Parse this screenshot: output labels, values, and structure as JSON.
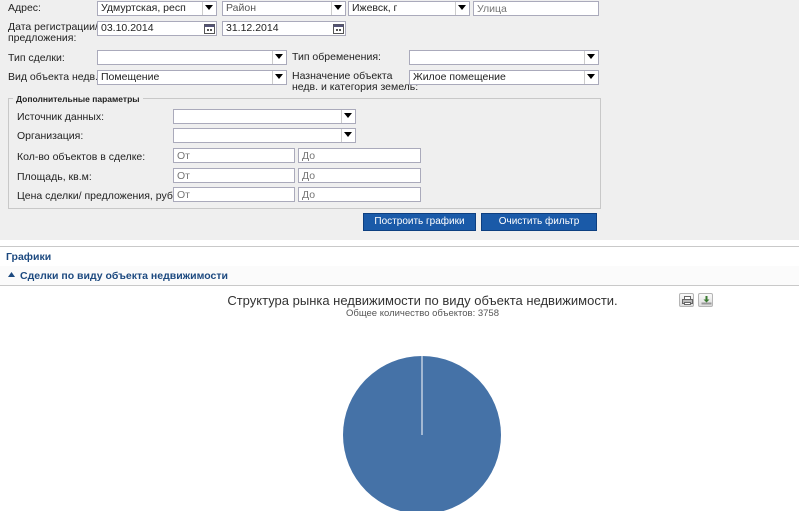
{
  "filter": {
    "address_label": "Адрес:",
    "region_value": "Удмуртская, респ",
    "district_placeholder": "Район",
    "city_value": "Ижевск, г",
    "street_placeholder": "Улица",
    "date_label_line1": "Дата регистрации/",
    "date_label_line2": "предложения:",
    "date_from": "03.10.2014",
    "date_to": "31.12.2014",
    "deal_type_label": "Тип сделки:",
    "deal_type_value": "",
    "encumbrance_label": "Тип обременения:",
    "encumbrance_value": "",
    "object_type_label": "Вид объекта недв.:",
    "object_type_value": "Помещение",
    "purpose_label_line1": "Назначение объекта",
    "purpose_label_line2": "недв. и категория земель:",
    "purpose_value": "Жилое помещение"
  },
  "extra": {
    "legend": "Дополнительные параметры",
    "source_label": "Источник данных:",
    "source_value": "",
    "org_label": "Организация:",
    "org_value": "",
    "count_label": "Кол-во объектов в сделке:",
    "area_label": "Площадь, кв.м:",
    "price_label": "Цена сделки/ предложения, руб.:",
    "from_placeholder": "От",
    "to_placeholder": "До"
  },
  "buttons": {
    "build": "Построить графики",
    "clear": "Очистить фильтр"
  },
  "sections": {
    "charts_header": "Графики",
    "subsection": "Сделки по виду объекта недвижимости"
  },
  "chart_data": {
    "type": "pie",
    "title": "Структура рынка недвижимости по виду объекта недвижимости.",
    "subtitle": "Общее количество объектов: 3758",
    "slices": [
      {
        "name": "",
        "value": 3758,
        "color": "#4572a7"
      }
    ],
    "total": 3758
  },
  "colors": {
    "button_bg": "#1a5aa8",
    "header_text": "#1d4a80",
    "pie_fill": "#4572a7",
    "filter_bg": "#efefef"
  },
  "icons": {
    "dropdown": "chevron-down-icon",
    "calendar": "calendar-icon",
    "print": "print-icon",
    "download": "download-icon",
    "collapse": "triangle-up-icon"
  }
}
